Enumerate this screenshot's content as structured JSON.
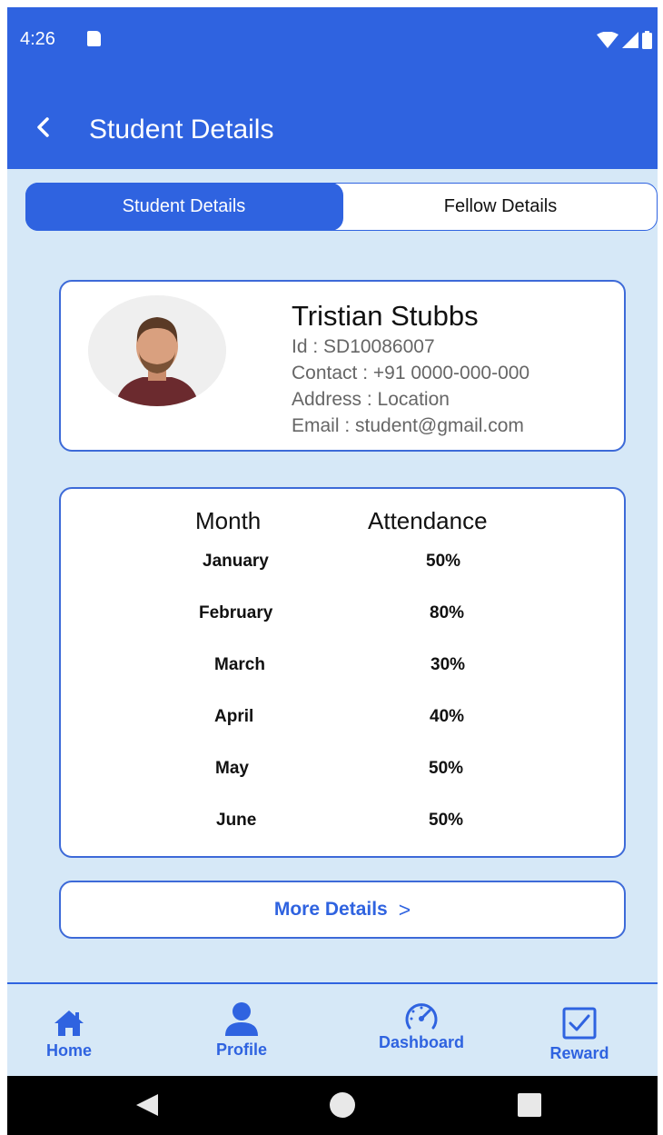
{
  "status": {
    "time": "4:26"
  },
  "appbar": {
    "title": "Student Details"
  },
  "tabs": [
    {
      "label": "Student Details",
      "active": true
    },
    {
      "label": "Fellow Details",
      "active": false
    }
  ],
  "student": {
    "name": "Tristian Stubbs",
    "id": "Id  :  SD10086007",
    "contact": "Contact  : +91 0000-000-000",
    "address": "Address  : Location",
    "email": "Email  : student@gmail.com"
  },
  "attendance": {
    "headers": {
      "month": "Month",
      "attendance": "Attendance"
    },
    "rows": [
      {
        "month": "January",
        "value": "50%"
      },
      {
        "month": "February",
        "value": "80%"
      },
      {
        "month": "March",
        "value": "30%"
      },
      {
        "month": "April",
        "value": "40%"
      },
      {
        "month": "May",
        "value": "50%"
      },
      {
        "month": "June",
        "value": "50%"
      }
    ]
  },
  "more": {
    "label": "More Details",
    "chevron": ">"
  },
  "nav": [
    {
      "label": "Home",
      "icon": "home-icon"
    },
    {
      "label": "Profile",
      "icon": "profile-icon"
    },
    {
      "label": "Dashboard",
      "icon": "dashboard-icon"
    },
    {
      "label": "Reward",
      "icon": "reward-icon"
    }
  ],
  "colors": {
    "primary": "#2f63e0",
    "background": "#d6e8f7"
  }
}
